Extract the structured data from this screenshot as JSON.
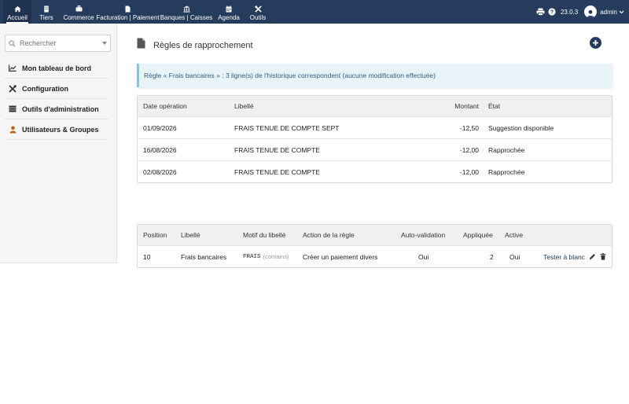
{
  "topbar": {
    "items": [
      {
        "label": "Accueil",
        "icon": "home-icon"
      },
      {
        "label": "Tiers",
        "icon": "building-icon"
      },
      {
        "label": "Commerce",
        "icon": "briefcase-icon"
      },
      {
        "label": "Facturation | Paiement",
        "icon": "file-icon"
      },
      {
        "label": "Banques | Caisses",
        "icon": "bank-icon"
      },
      {
        "label": "Agenda",
        "icon": "calendar-icon"
      },
      {
        "label": "Outils",
        "icon": "tools-icon"
      }
    ],
    "version": "23.0.3",
    "user": "admin"
  },
  "sidebar": {
    "search_placeholder": "Rechercher",
    "items": [
      {
        "label": "Mon tableau de bord",
        "icon": "chart-icon"
      },
      {
        "label": "Configuration",
        "icon": "wrench-icon"
      },
      {
        "label": "Outils d'administration",
        "icon": "server-icon"
      },
      {
        "label": "Utilisateurs & Groupes",
        "icon": "user-icon"
      }
    ]
  },
  "page": {
    "title": "Règles de rapprochement",
    "info": "Règle « Frais bancaires » : 3 ligne(s) de l'historique correspondent (aucune modification effectuée)"
  },
  "history_table": {
    "headers": [
      "Date opération",
      "Libellé",
      "Montant",
      "État"
    ],
    "rows": [
      {
        "date": "01/09/2026",
        "label": "FRAIS TENUE DE COMPTE SEPT",
        "amount": "-12,50",
        "state": "Suggestion disponible"
      },
      {
        "date": "16/08/2026",
        "label": "FRAIS TENUE DE COMPTE",
        "amount": "-12,00",
        "state": "Rapprochée"
      },
      {
        "date": "02/08/2026",
        "label": "FRAIS TENUE DE COMPTE",
        "amount": "-12,00",
        "state": "Rapprochée"
      }
    ]
  },
  "rules_table": {
    "headers": [
      "Position",
      "Libellé",
      "Motif du libellé",
      "Action de la règle",
      "Auto-validation",
      "Appliquée",
      "Active"
    ],
    "rows": [
      {
        "position": "10",
        "label": "Frais bancaires",
        "pattern": "FRAIS",
        "pattern_mode": "(contains)",
        "action": "Créer un paiement divers",
        "auto": "Oui",
        "applied": "2",
        "active": "Oui",
        "test_link": "Tester à blanc"
      }
    ]
  },
  "colors": {
    "topbar": "#263c5c",
    "info_bg": "#e9f4f9",
    "info_border": "#86c4d9",
    "info_text": "#2c5f85"
  }
}
